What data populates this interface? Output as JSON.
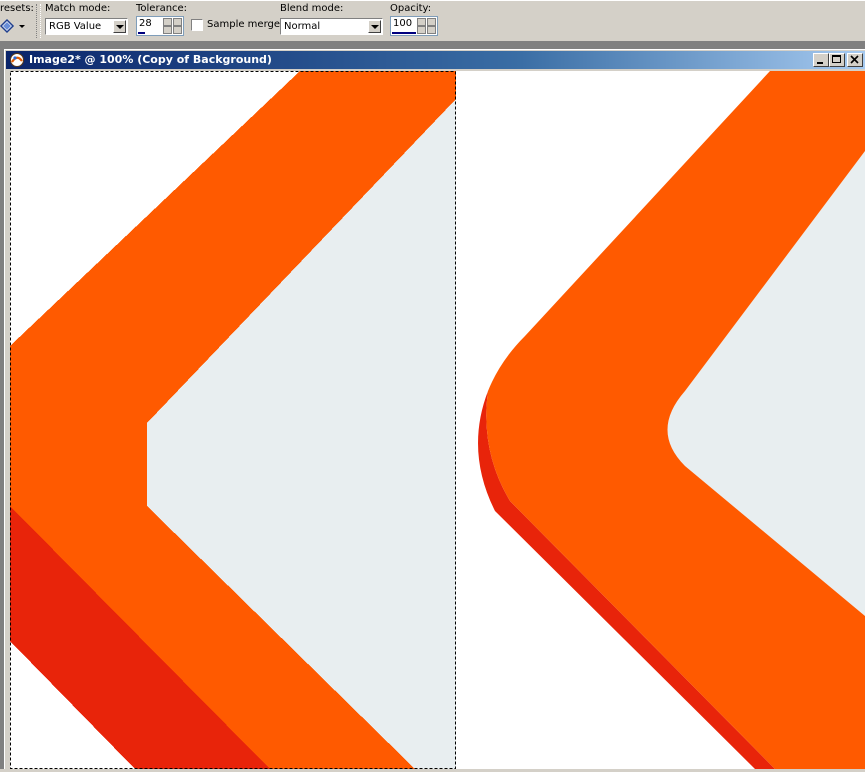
{
  "toolbar": {
    "presets_label": "resets:",
    "match_mode_label": "Match mode:",
    "match_mode_value": "RGB Value",
    "tolerance_label": "Tolerance:",
    "tolerance_value": "28",
    "sample_merged_label": "Sample merged",
    "sample_merged_checked": false,
    "blend_mode_label": "Blend mode:",
    "blend_mode_value": "Normal",
    "opacity_label": "Opacity:",
    "opacity_value": "100"
  },
  "document": {
    "title": "Image2* @ 100% (Copy of Background)",
    "buttons": [
      "minimize",
      "maximize",
      "close"
    ],
    "colors": {
      "stripe_orange": "#ff5a00",
      "shadow_red": "#e8240a",
      "inner_fill": "#e8eef0",
      "background": "#ffffff"
    },
    "selection": "dashed marquee around left half"
  }
}
